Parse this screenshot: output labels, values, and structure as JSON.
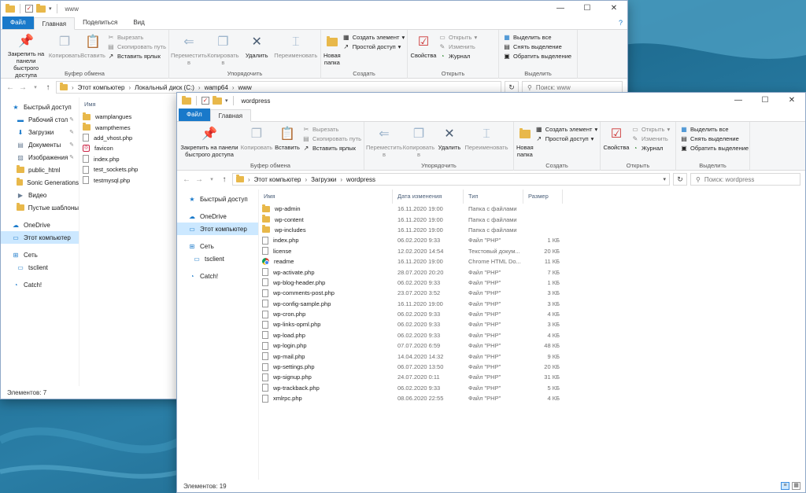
{
  "icons": {
    "quick_access": "star-icon",
    "desktop": "desktop-icon",
    "downloads": "download-icon",
    "documents": "document-icon",
    "pictures": "picture-icon",
    "folder": "folder-icon",
    "onedrive": "cloud-icon",
    "computer": "computer-icon",
    "network": "network-icon",
    "tsclient": "monitor-icon",
    "catch": "catch-icon",
    "php_file": "file-icon",
    "chrome": "chrome-icon",
    "favicon": "favicon-icon"
  },
  "colors": {
    "file_tab": "#1979ca",
    "selected": "#cce8ff",
    "folder": "#e8b84a"
  },
  "ribbon": {
    "tabs": {
      "file": "Файл",
      "home": "Главная",
      "share": "Поделиться",
      "view": "Вид"
    },
    "clipboard": {
      "pin": "Закрепить на панели быстрого доступа",
      "copy": "Копировать",
      "paste": "Вставить",
      "cut": "Вырезать",
      "copy_path": "Скопировать путь",
      "paste_shortcut": "Вставить ярлык",
      "label": "Буфер обмена"
    },
    "organize": {
      "move": "Переместить в",
      "copy_to": "Копировать в",
      "delete": "Удалить",
      "rename": "Переименовать",
      "label": "Упорядочить"
    },
    "new": {
      "new_folder": "Новая папка",
      "new_item": "Создать элемент",
      "easy_access": "Простой доступ",
      "label": "Создать"
    },
    "open": {
      "properties": "Свойства",
      "open": "Открыть",
      "edit": "Изменить",
      "history": "Журнал",
      "label": "Открыть"
    },
    "select": {
      "select_all": "Выделить все",
      "select_none": "Снять выделение",
      "invert": "Обратить выделение",
      "label": "Выделить"
    }
  },
  "back_window": {
    "title": "www",
    "breadcrumb": [
      "Этот компьютер",
      "Локальный диск (C:)",
      "wamp64",
      "www"
    ],
    "search_placeholder": "Поиск: www",
    "nav": {
      "quick_access": "Быстрый доступ",
      "desktop": "Рабочий стол",
      "downloads": "Загрузки",
      "documents": "Документы",
      "pictures": "Изображения",
      "public_html": "public_html",
      "sonic": "Sonic Generations",
      "videos": "Видео",
      "empty_templates": "Пустые шаблоны",
      "onedrive": "OneDrive",
      "this_pc": "Этот компьютер",
      "network": "Сеть",
      "tsclient": "tsclient",
      "catch": "Catch!"
    },
    "column_name": "Имя",
    "files": [
      {
        "name": "wamplangues",
        "kind": "folder"
      },
      {
        "name": "wampthemes",
        "kind": "folder"
      },
      {
        "name": "add_vhost.php",
        "kind": "file"
      },
      {
        "name": "favicon",
        "kind": "favicon"
      },
      {
        "name": "index.php",
        "kind": "file"
      },
      {
        "name": "test_sockets.php",
        "kind": "file"
      },
      {
        "name": "testmysql.php",
        "kind": "file"
      }
    ],
    "status": "Элементов: 7"
  },
  "front_window": {
    "title": "wordpress",
    "breadcrumb": [
      "Этот компьютер",
      "Загрузки",
      "wordpress"
    ],
    "search_placeholder": "Поиск: wordpress",
    "nav": {
      "quick_access": "Быстрый доступ",
      "onedrive": "OneDrive",
      "this_pc": "Этот компьютер",
      "network": "Сеть",
      "tsclient": "tsclient",
      "catch": "Catch!"
    },
    "columns": {
      "name": "Имя",
      "date": "Дата изменения",
      "type": "Тип",
      "size": "Размер"
    },
    "files": [
      {
        "name": "wp-admin",
        "date": "16.11.2020 19:00",
        "type": "Папка с файлами",
        "size": "",
        "kind": "folder"
      },
      {
        "name": "wp-content",
        "date": "16.11.2020 19:00",
        "type": "Папка с файлами",
        "size": "",
        "kind": "folder"
      },
      {
        "name": "wp-includes",
        "date": "16.11.2020 19:00",
        "type": "Папка с файлами",
        "size": "",
        "kind": "folder"
      },
      {
        "name": "index.php",
        "date": "06.02.2020 9:33",
        "type": "Файл \"PHP\"",
        "size": "1 КБ",
        "kind": "file"
      },
      {
        "name": "license",
        "date": "12.02.2020 14:54",
        "type": "Текстовый докум...",
        "size": "20 КБ",
        "kind": "file"
      },
      {
        "name": "readme",
        "date": "16.11.2020 19:00",
        "type": "Chrome HTML Do...",
        "size": "11 КБ",
        "kind": "chrome"
      },
      {
        "name": "wp-activate.php",
        "date": "28.07.2020 20:20",
        "type": "Файл \"PHP\"",
        "size": "7 КБ",
        "kind": "file"
      },
      {
        "name": "wp-blog-header.php",
        "date": "06.02.2020 9:33",
        "type": "Файл \"PHP\"",
        "size": "1 КБ",
        "kind": "file"
      },
      {
        "name": "wp-comments-post.php",
        "date": "23.07.2020 3:52",
        "type": "Файл \"PHP\"",
        "size": "3 КБ",
        "kind": "file"
      },
      {
        "name": "wp-config-sample.php",
        "date": "16.11.2020 19:00",
        "type": "Файл \"PHP\"",
        "size": "3 КБ",
        "kind": "file"
      },
      {
        "name": "wp-cron.php",
        "date": "06.02.2020 9:33",
        "type": "Файл \"PHP\"",
        "size": "4 КБ",
        "kind": "file"
      },
      {
        "name": "wp-links-opml.php",
        "date": "06.02.2020 9:33",
        "type": "Файл \"PHP\"",
        "size": "3 КБ",
        "kind": "file"
      },
      {
        "name": "wp-load.php",
        "date": "06.02.2020 9:33",
        "type": "Файл \"PHP\"",
        "size": "4 КБ",
        "kind": "file"
      },
      {
        "name": "wp-login.php",
        "date": "07.07.2020 6:59",
        "type": "Файл \"PHP\"",
        "size": "48 КБ",
        "kind": "file"
      },
      {
        "name": "wp-mail.php",
        "date": "14.04.2020 14:32",
        "type": "Файл \"PHP\"",
        "size": "9 КБ",
        "kind": "file"
      },
      {
        "name": "wp-settings.php",
        "date": "06.07.2020 13:50",
        "type": "Файл \"PHP\"",
        "size": "20 КБ",
        "kind": "file"
      },
      {
        "name": "wp-signup.php",
        "date": "24.07.2020 0:11",
        "type": "Файл \"PHP\"",
        "size": "31 КБ",
        "kind": "file"
      },
      {
        "name": "wp-trackback.php",
        "date": "06.02.2020 9:33",
        "type": "Файл \"PHP\"",
        "size": "5 КБ",
        "kind": "file"
      },
      {
        "name": "xmlrpc.php",
        "date": "08.06.2020 22:55",
        "type": "Файл \"PHP\"",
        "size": "4 КБ",
        "kind": "file"
      }
    ],
    "status": "Элементов: 19"
  }
}
